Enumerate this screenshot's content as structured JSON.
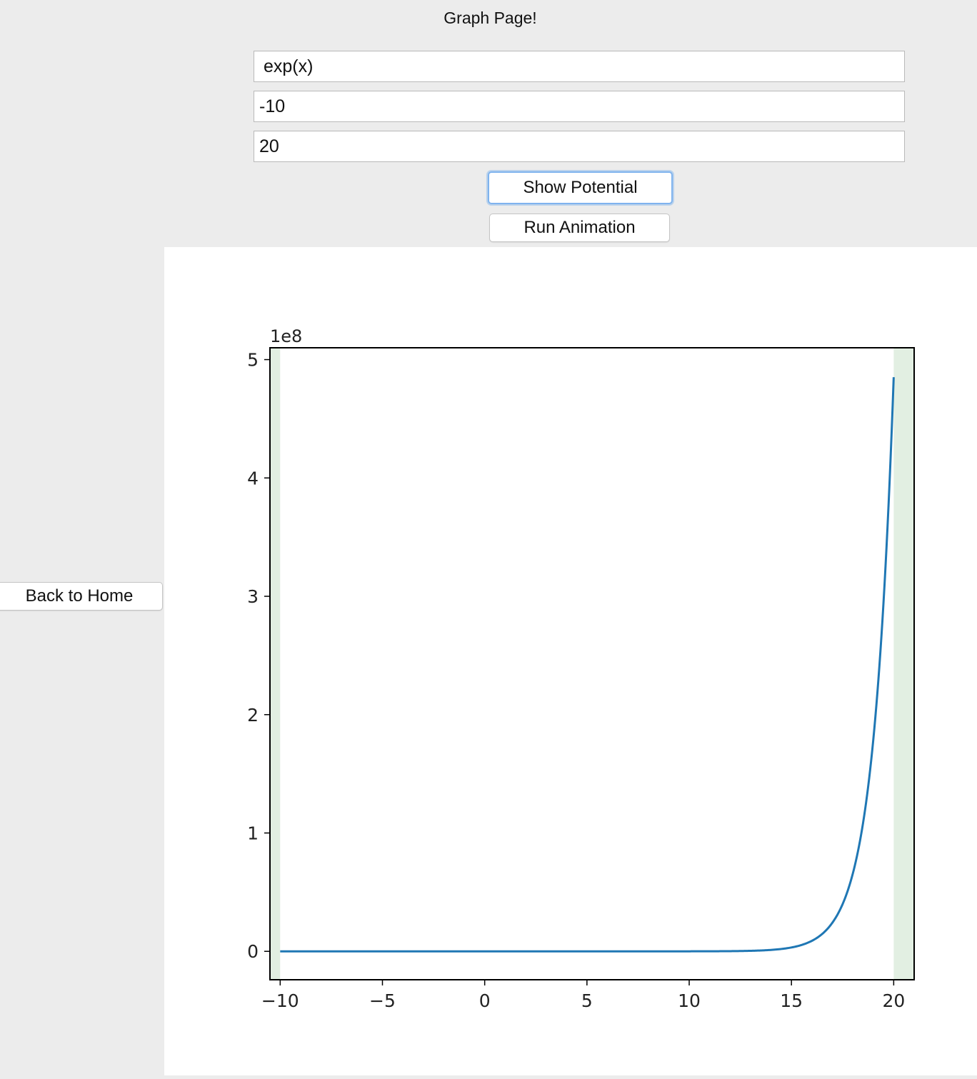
{
  "page": {
    "title": "Graph Page!"
  },
  "inputs": {
    "function": "exp(x)",
    "x_min": "-10",
    "x_max": "20"
  },
  "buttons": {
    "show_potential": "Show Potential",
    "run_animation": "Run Animation",
    "back_home": "Back to Home"
  },
  "chart_data": {
    "type": "line",
    "title": "",
    "xlabel": "",
    "ylabel": "",
    "y_offset_label": "1e8",
    "xlim": [
      -10.5,
      21.0
    ],
    "ylim": [
      -0.24,
      5.1
    ],
    "y_scale_multiplier": 100000000,
    "x_ticks": [
      -10,
      -5,
      0,
      5,
      10,
      15,
      20
    ],
    "x_tick_labels": [
      "−10",
      "−5",
      "0",
      "5",
      "10",
      "15",
      "20"
    ],
    "y_ticks": [
      0,
      1,
      2,
      3,
      4,
      5
    ],
    "y_tick_labels": [
      "0",
      "1",
      "2",
      "3",
      "4",
      "5"
    ],
    "series": [
      {
        "function": "exp(x)",
        "x_range": [
          -10,
          20
        ],
        "color": "#1f77b4"
      }
    ],
    "shaded_regions": [
      {
        "x_range": [
          -10.5,
          -10
        ],
        "color": "#e2efe2"
      },
      {
        "x_range": [
          20,
          21.0
        ],
        "color": "#e2efe2"
      }
    ],
    "grid": false
  }
}
